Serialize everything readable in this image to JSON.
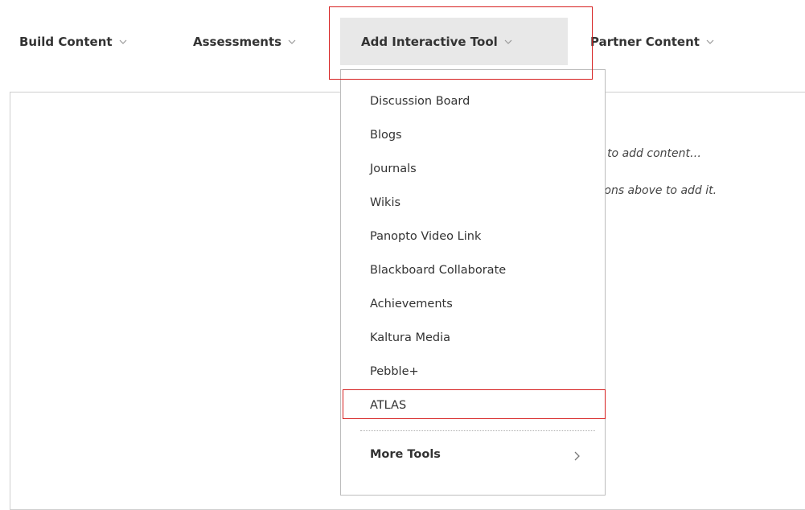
{
  "toolbar": {
    "items": [
      {
        "label": "Build Content"
      },
      {
        "label": "Assessments"
      },
      {
        "label": "Add Interactive Tool"
      },
      {
        "label": "Partner Content"
      }
    ]
  },
  "content": {
    "hint_line_1": "e to add content…",
    "hint_line_2": "tions above to add it."
  },
  "dropdown": {
    "items": [
      {
        "label": "Discussion Board"
      },
      {
        "label": "Blogs"
      },
      {
        "label": "Journals"
      },
      {
        "label": "Wikis"
      },
      {
        "label": "Panopto Video Link"
      },
      {
        "label": "Blackboard Collaborate"
      },
      {
        "label": "Achievements"
      },
      {
        "label": "Kaltura Media"
      },
      {
        "label": "Pebble+"
      },
      {
        "label": "ATLAS"
      }
    ],
    "more_tools_label": "More Tools"
  },
  "colors": {
    "highlight": "#d62020",
    "active_tab_bg": "#e8e8e8",
    "text": "#333333"
  },
  "icons": {
    "toolbar_chevron": "chevron-down-icon",
    "more_tools_chevron": "chevron-right-icon"
  }
}
